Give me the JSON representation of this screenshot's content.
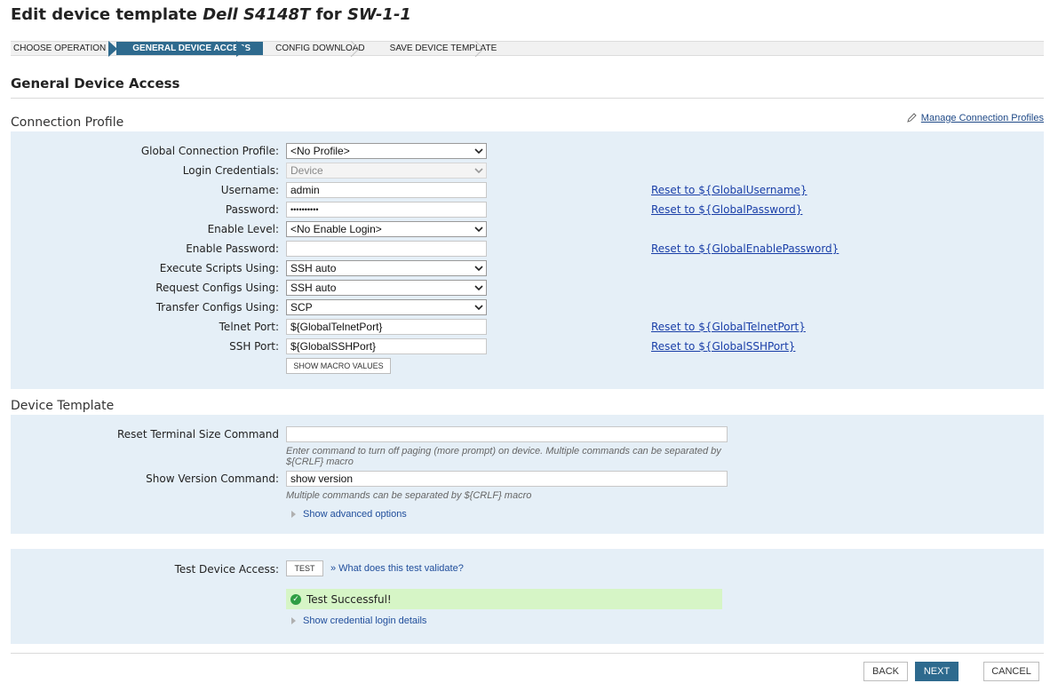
{
  "page": {
    "title_prefix": "Edit device template ",
    "template_name": "Dell S4148T",
    "title_mid": " for ",
    "device_name": "SW-1-1"
  },
  "wizard": {
    "steps": [
      {
        "label": "CHOOSE OPERATION"
      },
      {
        "label": "GENERAL DEVICE ACCESS"
      },
      {
        "label": "CONFIG DOWNLOAD"
      },
      {
        "label": "SAVE DEVICE TEMPLATE"
      }
    ],
    "active_index": 1
  },
  "section": {
    "title": "General Device Access"
  },
  "connection_profile": {
    "title": "Connection Profile",
    "manage_link": "Manage Connection Profiles",
    "fields": {
      "global_profile": {
        "label": "Global Connection Profile:",
        "value": "<No Profile>"
      },
      "login_credentials": {
        "label": "Login Credentials:",
        "value": "Device"
      },
      "username": {
        "label": "Username:",
        "value": "admin",
        "reset": "Reset to ${GlobalUsername}"
      },
      "password": {
        "label": "Password:",
        "value": "••••••••••",
        "reset": "Reset to ${GlobalPassword}"
      },
      "enable_level": {
        "label": "Enable Level:",
        "value": "<No Enable Login>"
      },
      "enable_password": {
        "label": "Enable Password:",
        "value": "",
        "reset": "Reset to ${GlobalEnablePassword}"
      },
      "execute_scripts": {
        "label": "Execute Scripts Using:",
        "value": "SSH auto"
      },
      "request_configs": {
        "label": "Request Configs Using:",
        "value": "SSH auto"
      },
      "transfer_configs": {
        "label": "Transfer Configs Using:",
        "value": "SCP"
      },
      "telnet_port": {
        "label": "Telnet Port:",
        "value": "${GlobalTelnetPort}",
        "reset": "Reset to ${GlobalTelnetPort}"
      },
      "ssh_port": {
        "label": "SSH Port:",
        "value": "${GlobalSSHPort}",
        "reset": "Reset to ${GlobalSSHPort}"
      }
    },
    "show_macro_button": "SHOW MACRO VALUES"
  },
  "device_template": {
    "title": "Device Template",
    "reset_terminal": {
      "label": "Reset Terminal Size Command",
      "value": "",
      "hint": "Enter command to turn off paging (more prompt) on device. Multiple commands can be separated by ${CRLF} macro"
    },
    "show_version": {
      "label": "Show Version Command:",
      "value": "show version",
      "hint": "Multiple commands can be separated by ${CRLF} macro"
    },
    "advanced_link": "Show advanced options"
  },
  "test": {
    "label": "Test Device Access:",
    "button": "TEST",
    "validate_link": "» What does this test validate?",
    "result": "Test Successful!",
    "details_link": "Show credential login details"
  },
  "footer": {
    "back": "BACK",
    "next": "NEXT",
    "cancel": "CANCEL"
  },
  "colors": {
    "accent": "#2e6a8e",
    "panel": "#e5eff7",
    "success": "#d6f5c6"
  }
}
